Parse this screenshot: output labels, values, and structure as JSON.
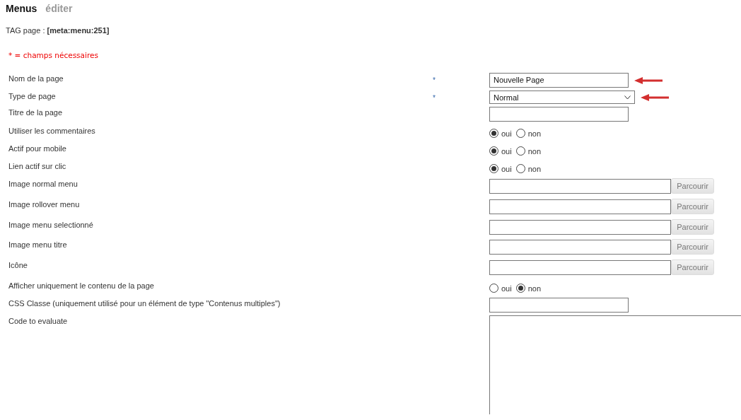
{
  "header": {
    "title": "Menus",
    "action": "éditer"
  },
  "tag": {
    "label": "TAG page :",
    "value": "[meta:menu:251]"
  },
  "required_note": "* = champs nécessaires",
  "fields": [
    {
      "kind": "text",
      "label": "Nom de la page",
      "required_mark": "*",
      "value": "Nouvelle Page",
      "arrow": true
    },
    {
      "kind": "select",
      "label": "Type de page",
      "required_mark": "*",
      "value": "Normal",
      "arrow": true
    },
    {
      "kind": "text",
      "label": "Titre de la page",
      "arrow": false
    },
    {
      "kind": "radio",
      "label": "Utiliser les commentaires",
      "options": [
        {
          "label": "oui",
          "selected": true
        },
        {
          "label": "non",
          "selected": false
        }
      ]
    },
    {
      "kind": "radio",
      "label": "Actif pour mobile",
      "options": [
        {
          "label": "oui",
          "selected": true
        },
        {
          "label": "non",
          "selected": false
        }
      ]
    },
    {
      "kind": "radio",
      "label": "Lien actif sur clic",
      "options": [
        {
          "label": "oui",
          "selected": true
        },
        {
          "label": "non",
          "selected": false
        }
      ]
    },
    {
      "kind": "file",
      "label": "Image normal menu",
      "button": "Parcourir"
    },
    {
      "kind": "file",
      "label": "Image rollover menu",
      "button": "Parcourir"
    },
    {
      "kind": "file",
      "label": "Image menu selectionné",
      "button": "Parcourir"
    },
    {
      "kind": "file",
      "label": "Image menu titre",
      "button": "Parcourir"
    },
    {
      "kind": "file",
      "label": "Icône",
      "button": "Parcourir"
    },
    {
      "kind": "radio",
      "label": "Afficher uniquement le contenu de la page",
      "options": [
        {
          "label": "oui",
          "selected": false
        },
        {
          "label": "non",
          "selected": true
        }
      ]
    },
    {
      "kind": "text",
      "label": "CSS Classe (uniquement utilisé pour un élément de type \"Contenus multiples\")",
      "arrow": false
    },
    {
      "kind": "textarea",
      "label": "Code to evaluate"
    }
  ]
}
